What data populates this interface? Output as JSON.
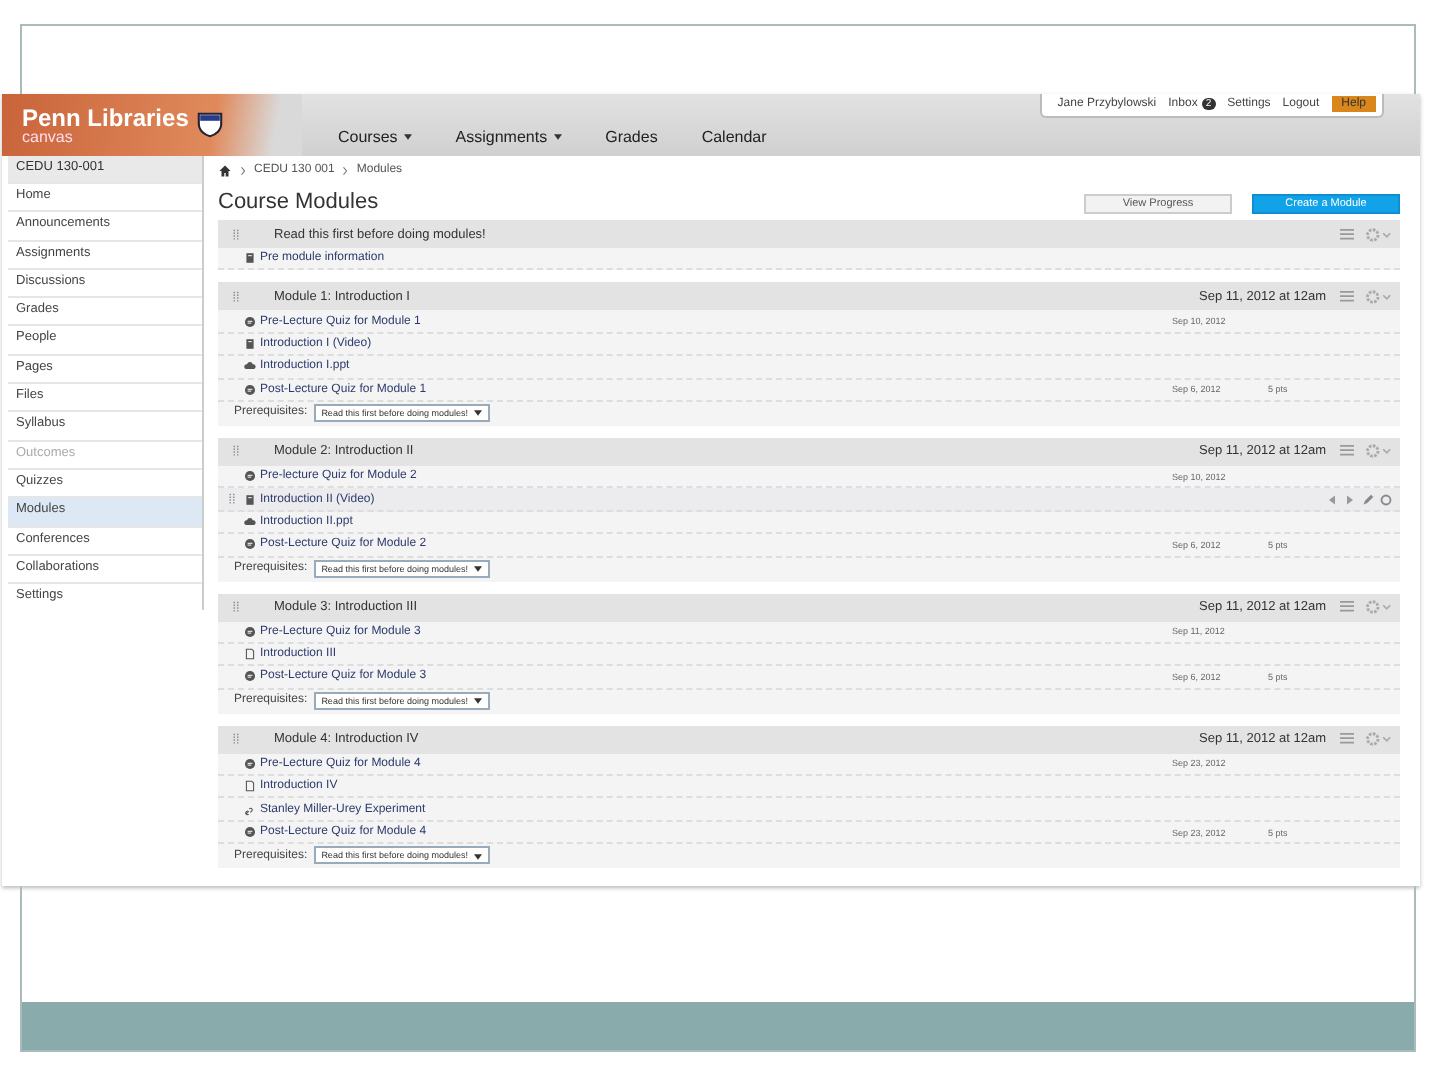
{
  "header": {
    "logo_title": "Penn Libraries",
    "logo_subtitle": "canvas",
    "nav": [
      {
        "label": "Courses",
        "dropdown": true
      },
      {
        "label": "Assignments",
        "dropdown": true
      },
      {
        "label": "Grades",
        "dropdown": false
      },
      {
        "label": "Calendar",
        "dropdown": false
      }
    ],
    "user": "Jane Przybylowski",
    "inbox": "Inbox",
    "inbox_count": "2",
    "settings": "Settings",
    "logout": "Logout",
    "help": "Help"
  },
  "sidebar": {
    "course": "CEDU 130-001",
    "items": [
      {
        "label": "Home",
        "selected": false,
        "disabled": false
      },
      {
        "label": "Announcements",
        "selected": false,
        "disabled": false
      },
      {
        "label": "Assignments",
        "selected": false,
        "disabled": false
      },
      {
        "label": "Discussions",
        "selected": false,
        "disabled": false
      },
      {
        "label": "Grades",
        "selected": false,
        "disabled": false
      },
      {
        "label": "People",
        "selected": false,
        "disabled": false
      },
      {
        "label": "Pages",
        "selected": false,
        "disabled": false
      },
      {
        "label": "Files",
        "selected": false,
        "disabled": false
      },
      {
        "label": "Syllabus",
        "selected": false,
        "disabled": false
      },
      {
        "label": "Outcomes",
        "selected": false,
        "disabled": true
      },
      {
        "label": "Quizzes",
        "selected": false,
        "disabled": false
      },
      {
        "label": "Modules",
        "selected": true,
        "disabled": false
      },
      {
        "label": "Conferences",
        "selected": false,
        "disabled": false
      },
      {
        "label": "Collaborations",
        "selected": false,
        "disabled": false
      },
      {
        "label": "Settings",
        "selected": false,
        "disabled": false
      }
    ]
  },
  "breadcrumb": [
    "CEDU 130 001",
    "Modules"
  ],
  "page_title": "Course Modules",
  "buttons": {
    "view_progress": "View Progress",
    "create": "Create a Module"
  },
  "modules": [
    {
      "title": "Read this first before doing modules!",
      "items": [
        {
          "kind": "page",
          "title": "Pre module information",
          "hovered": false
        }
      ]
    },
    {
      "title": "Module 1: Introduction I",
      "date": "Sep 11, 2012 at 12am",
      "items": [
        {
          "kind": "quiz",
          "title": "Pre-Lecture Quiz for Module 1",
          "due": "Sep 10, 2012",
          "hovered": false
        },
        {
          "kind": "page",
          "title": "Introduction I (Video)",
          "hovered": false
        },
        {
          "kind": "attachment",
          "title": "Introduction I.ppt",
          "hovered": false
        },
        {
          "kind": "quiz",
          "title": "Post-Lecture Quiz for Module 1",
          "due": "Sep 6, 2012",
          "points": "5 pts",
          "hovered": false
        }
      ],
      "prerequisites_label": "Prerequisites:",
      "prerequisite": "Read this first before doing modules!"
    },
    {
      "title": "Module 2: Introduction II",
      "date": "Sep 11, 2012 at 12am",
      "items": [
        {
          "kind": "quiz",
          "title": "Pre-lecture Quiz for Module 2",
          "due": "Sep 10, 2012",
          "hovered": false
        },
        {
          "kind": "page",
          "title": "Introduction II (Video)",
          "hovered": true
        },
        {
          "kind": "attachment",
          "title": "Introduction II.ppt",
          "hovered": false
        },
        {
          "kind": "quiz",
          "title": "Post-Lecture Quiz for Module 2",
          "due": "Sep 6, 2012",
          "points": "5 pts",
          "hovered": false
        }
      ],
      "prerequisites_label": "Prerequisites:",
      "prerequisite": "Read this first before doing modules!"
    },
    {
      "title": "Module 3: Introduction III",
      "date": "Sep 11, 2012 at 12am",
      "items": [
        {
          "kind": "quiz",
          "title": "Pre-Lecture Quiz for Module 3",
          "due": "Sep 11, 2012",
          "hovered": false
        },
        {
          "kind": "document",
          "title": "Introduction III",
          "hovered": false
        },
        {
          "kind": "quiz",
          "title": "Post-Lecture Quiz for Module 3",
          "due": "Sep 6, 2012",
          "points": "5 pts",
          "hovered": false
        }
      ],
      "prerequisites_label": "Prerequisites:",
      "prerequisite": "Read this first before doing modules!"
    },
    {
      "title": "Module 4: Introduction IV",
      "date": "Sep 11, 2012 at 12am",
      "items": [
        {
          "kind": "quiz",
          "title": "Pre-Lecture Quiz for Module 4",
          "due": "Sep 23, 2012",
          "hovered": false
        },
        {
          "kind": "document",
          "title": "Introduction IV",
          "hovered": false
        },
        {
          "kind": "link",
          "title": "Stanley Miller-Urey Experiment",
          "hovered": false
        },
        {
          "kind": "quiz",
          "title": "Post-Lecture Quiz for Module 4",
          "due": "Sep 23, 2012",
          "points": "5 pts",
          "hovered": false
        }
      ],
      "prerequisites_label": "Prerequisites:",
      "prerequisite": "Read this first before doing modules!"
    }
  ]
}
